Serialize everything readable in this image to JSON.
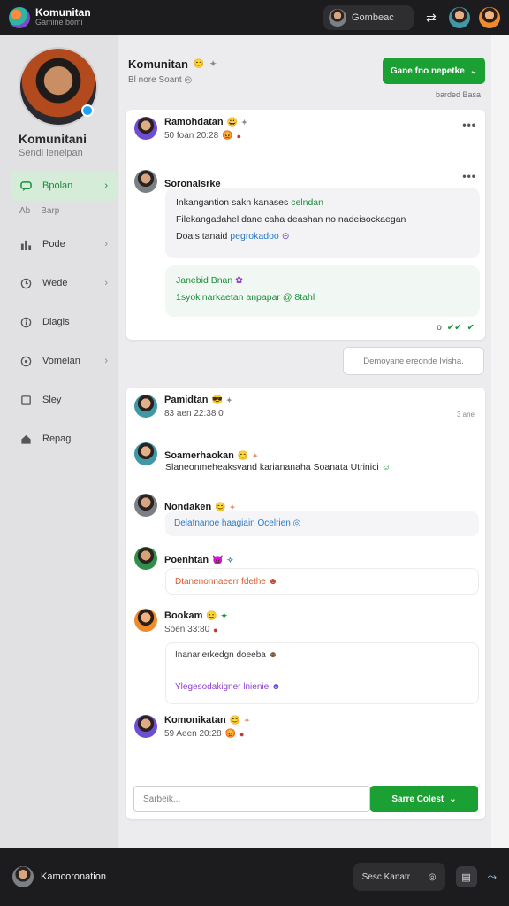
{
  "app": {
    "title": "Komunitan",
    "subtitle": "Gamine bomi"
  },
  "topbar": {
    "chip_label": "Gombeac"
  },
  "profile": {
    "name": "Komunitani",
    "subtitle": "Sendi lenelpan"
  },
  "sidebar": {
    "items": [
      {
        "label": "Bpolan",
        "icon": "chat-icon",
        "active": true,
        "sub": [
          "Ab",
          "Barp"
        ]
      },
      {
        "label": "Pode",
        "icon": "chart-icon"
      },
      {
        "label": "Wede",
        "icon": "clock-icon"
      },
      {
        "label": "Diagis",
        "icon": "info-icon"
      },
      {
        "label": "Vomelan",
        "icon": "settings-icon"
      },
      {
        "label": "Sley",
        "icon": "book-icon"
      },
      {
        "label": "Repag",
        "icon": "home-icon"
      }
    ]
  },
  "header": {
    "title": "Komunitan",
    "subtitle": "Bl nore Soant",
    "button": "Gane fno nepetke",
    "meta": "barded Basa"
  },
  "thread1": {
    "author": "Ramohdatan",
    "meta": "50 foan 20:28",
    "reply": {
      "author": "Soronalsrke",
      "line1_prefix": "Inkangantion sakn kanases",
      "line1_link": "celndan",
      "line2": "Filekangadahel dane caha deashan no nadeisockaegan",
      "line3_prefix": "Doais tanaid",
      "line3_link": "pegrokadoo",
      "quote_title": "Janebid Bnan",
      "quote_text": "1syokinarkaetan anpapar @ 8tahl"
    },
    "status": "o"
  },
  "reply_placeholder": "Demoyane ereonde Ivisha.",
  "thread2": {
    "author": "Pamidtan",
    "meta": "83 aen 22:38 0",
    "meta_right": "3 ane",
    "comments": [
      {
        "author": "Soamerhaokan",
        "text": "Slaneonmeheaksvand kariananaha Soanata Utrinici"
      },
      {
        "author": "Nondaken",
        "text": "Delatnanoe haagiain Ocelrien"
      },
      {
        "author": "Poenhtan",
        "text": "Dtanenonnaeerr fdethe"
      },
      {
        "author": "Bookam",
        "meta": "Soen 33:80",
        "text1": "Inanarlerkedgn doeeba",
        "text2": "Ylegesodakigner lnienie"
      },
      {
        "author": "Komonikatan",
        "meta": "59 Aeen 20:28"
      }
    ]
  },
  "composer": {
    "placeholder": "Sarbeik...",
    "button": "Sarre Colest"
  },
  "bottombar": {
    "user": "Kamcoronation",
    "chip": "Sesc Kanatr"
  }
}
